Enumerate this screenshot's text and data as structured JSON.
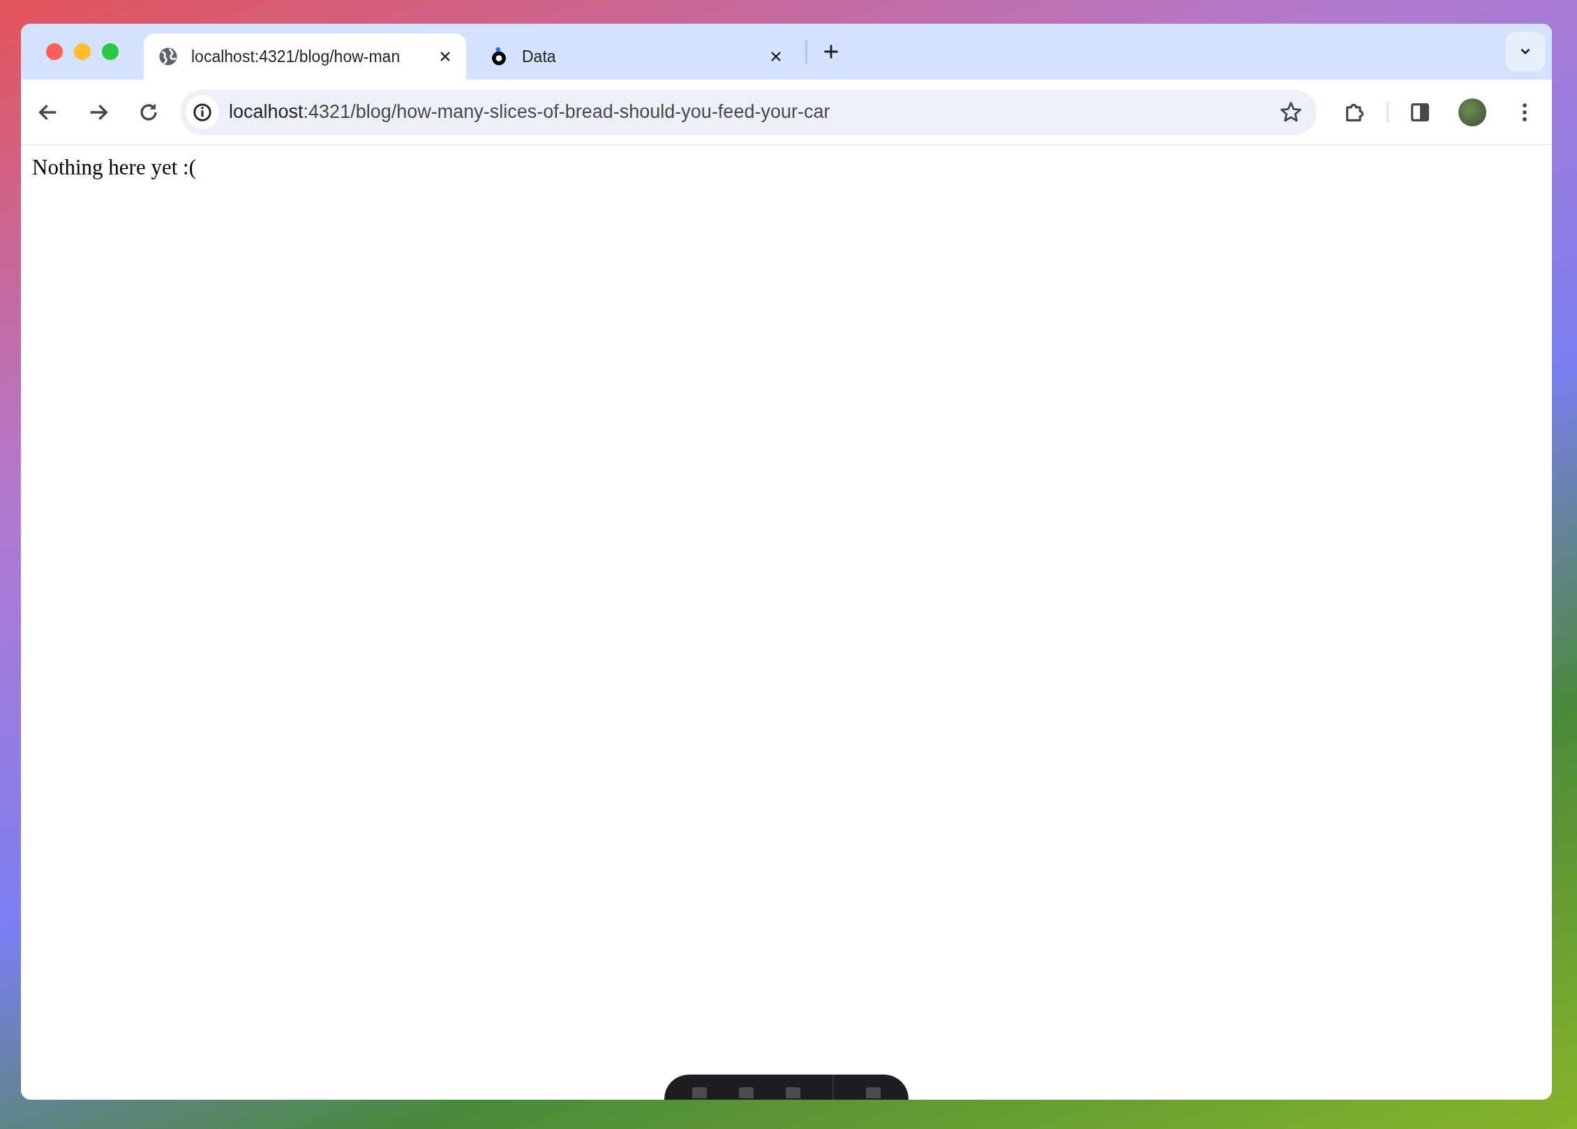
{
  "tabs": [
    {
      "title": "localhost:4321/blog/how-man",
      "selected": true,
      "kind": "globe"
    },
    {
      "title": "Data",
      "selected": false,
      "kind": "logo"
    }
  ],
  "address_bar": {
    "host": "localhost",
    "rest": ":4321/blog/how-many-slices-of-bread-should-you-feed-your-car"
  },
  "page": {
    "text": "Nothing here yet :("
  }
}
